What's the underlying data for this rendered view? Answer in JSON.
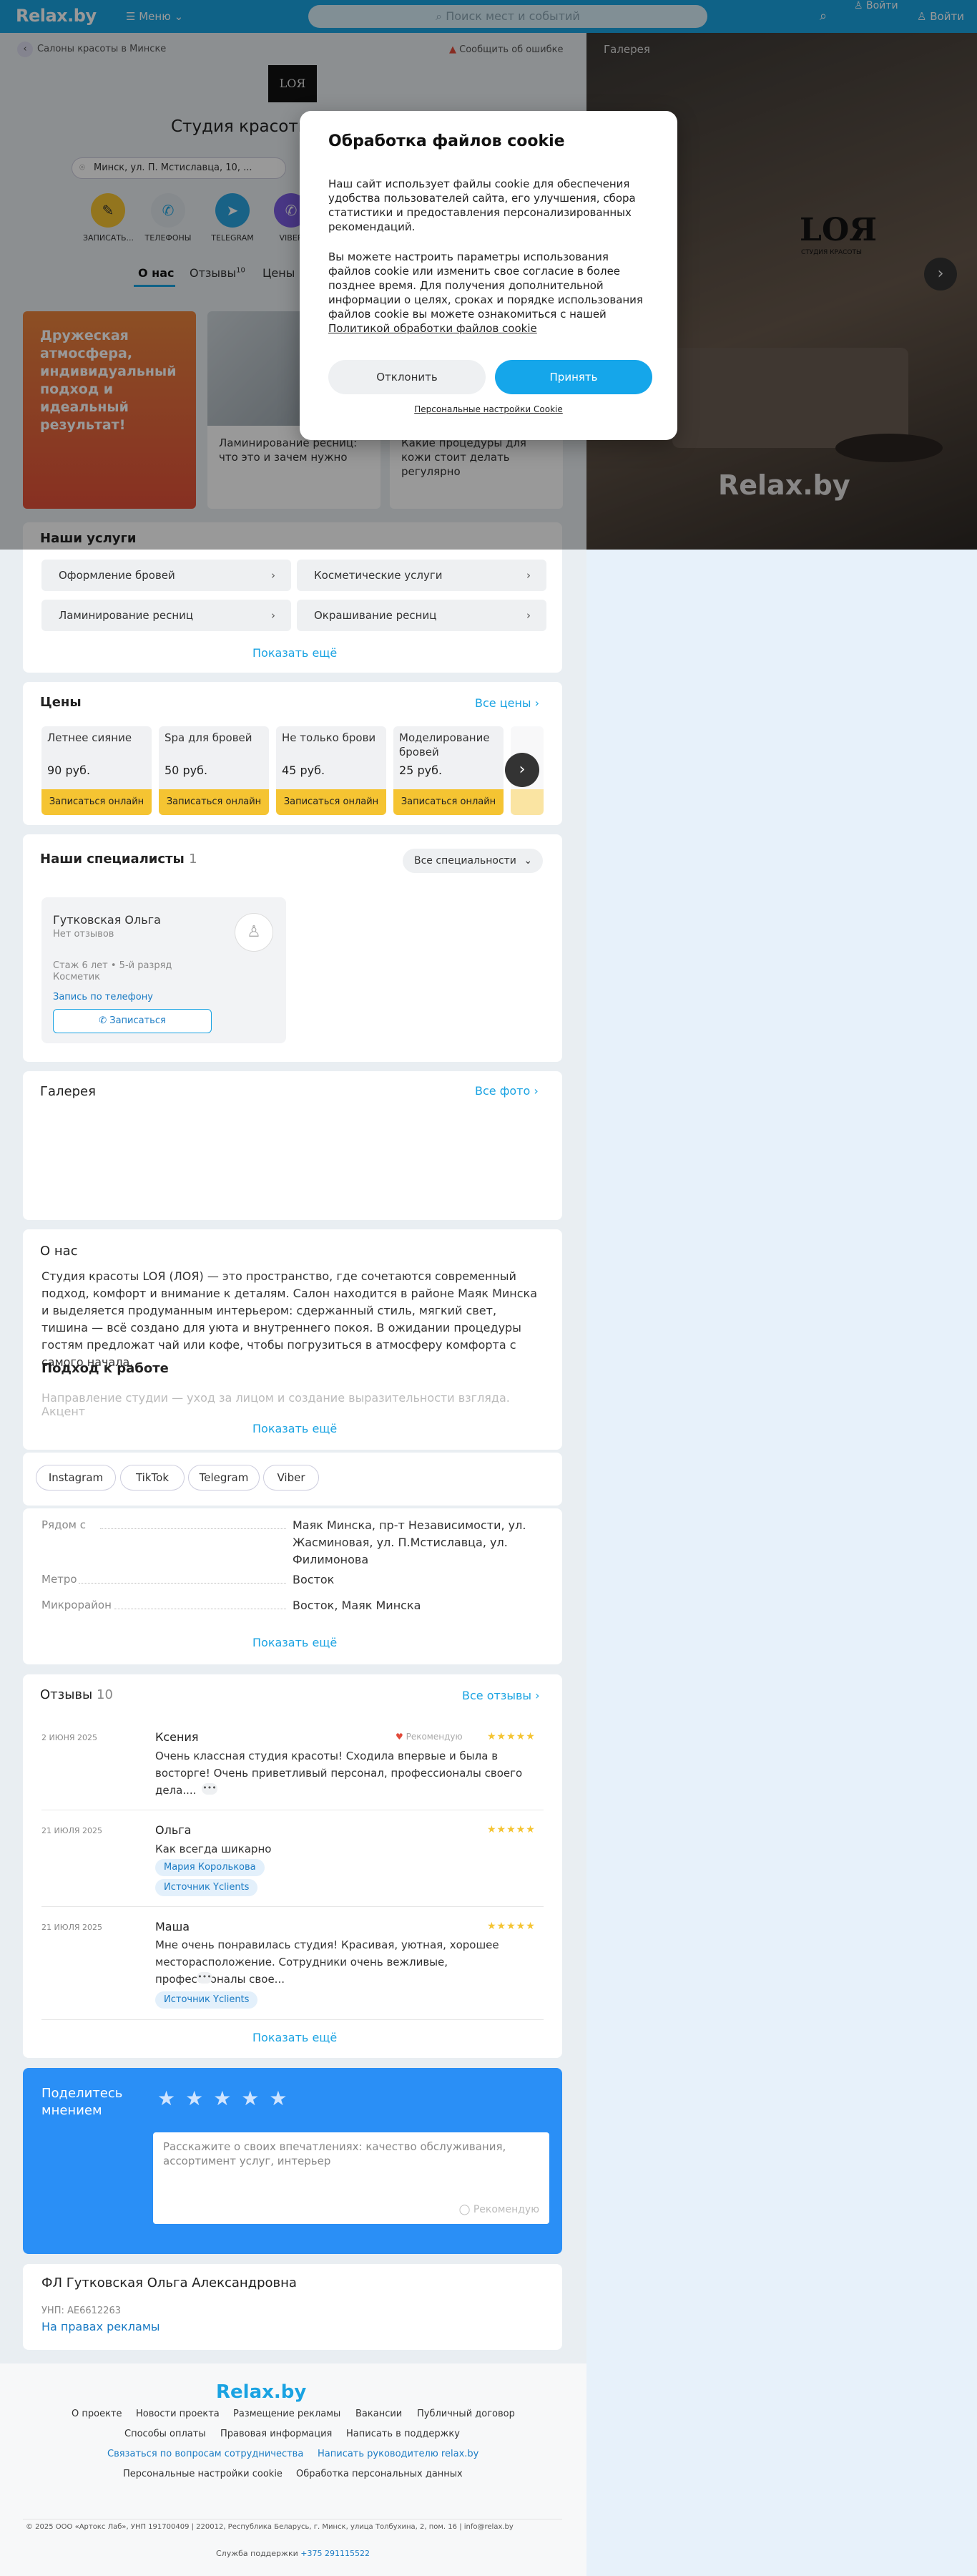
{
  "header": {
    "logo": "Relax.by",
    "menu": "Меню",
    "search_placeholder": "Поиск мест и событий",
    "login1": "Войти",
    "login2": "Войти"
  },
  "breadcrumb": {
    "back": "Салоны красоты в Минске",
    "report": "Сообщить об ошибке"
  },
  "salon": {
    "logo_text": "LOЯ",
    "title": "Студия красоты LOЯ (ЛОЯ)",
    "address": "Минск, ул. П. Мстиславца, 10, ...",
    "actions": [
      "ЗАПИСАТЬ...",
      "ТЕЛЕФОНЫ",
      "TELEGRAM",
      "VIBER"
    ]
  },
  "tabs": {
    "about": "О нас",
    "reviews": "Отзывы",
    "reviews_count": "10",
    "prices": "Цены"
  },
  "promo": {
    "text": "Дружеская атмосфера, индивидуальный подход и идеальный результат!"
  },
  "articles": [
    {
      "title": "Ламинирование ресниц: что это и зачем нужно"
    },
    {
      "title": "Какие процедуры для кожи стоит делать регулярно"
    }
  ],
  "services": {
    "title": "Наши услуги",
    "items": [
      "Оформление бровей",
      "Косметические услуги",
      "Ламинирование ресниц",
      "Окрашивание ресниц"
    ],
    "more": "Показать ещё"
  },
  "prices": {
    "title": "Цены",
    "all": "Все цены",
    "items": [
      {
        "name": "Летнее сияние",
        "price": "90 руб."
      },
      {
        "name": "Spa для бровей",
        "price": "50 руб."
      },
      {
        "name": "Не только брови",
        "price": "45 руб."
      },
      {
        "name": "Моделирование бровей",
        "price": "25 руб."
      }
    ],
    "book": "Записаться онлайн"
  },
  "specialists": {
    "title": "Наши специалисты",
    "count": "1",
    "filter": "Все специальности",
    "card": {
      "name": "Гутковская Ольга",
      "reviews": "Нет отзывов",
      "exp": "Стаж 6 лет • 5-й разряд",
      "role": "Косметик",
      "phone_link": "Запись по телефону",
      "book": "Записаться"
    }
  },
  "gallery_section": {
    "title": "Галерея",
    "all": "Все фото"
  },
  "about": {
    "title": "О нас",
    "p1": "Студия красоты LOЯ (ЛОЯ) — это пространство, где сочетаются современный подход, комфорт и внимание к деталям. Салон находится в районе Маяк Минска и выделяется продуманным интерьером: сдержанный стиль, мягкий свет, тишина — всё создано для уюта и внутреннего покоя. В ожидании процедуры гостям предложат чай или кофе, чтобы погрузиться в атмосферу комфорта с самого начала.",
    "h2": "Подход к работе",
    "p2": "Направление студии — уход за лицом и создание выразительности взгляда. Акцент",
    "more": "Показать ещё"
  },
  "social": [
    "Instagram",
    "TikTok",
    "Telegram",
    "Viber"
  ],
  "info": {
    "rows": [
      {
        "k": "Рядом с",
        "v": "Маяк Минска, пр-т Независимости, ул. Жасминовая, ул. П.Мстиславца, ул. Филимонова"
      },
      {
        "k": "Метро",
        "v": "Восток"
      },
      {
        "k": "Микрорайон",
        "v": "Восток, Маяк Минска"
      }
    ],
    "more": "Показать ещё"
  },
  "reviews": {
    "title": "Отзывы",
    "count": "10",
    "all": "Все отзывы",
    "recommend": "Рекомендую",
    "items": [
      {
        "date": "2 ИЮНЯ 2025",
        "name": "Ксения",
        "text": "Очень классная студия красоты! Сходила впервые и была в восторге! Очень приветливый персонал, профессионалы своего дела...."
      },
      {
        "date": "21 ИЮЛЯ 2025",
        "name": "Ольга",
        "text": "Как всегда шикарно",
        "chip1": "Мария Королькова",
        "chip2": "Источник Yclients"
      },
      {
        "date": "21 ИЮЛЯ 2025",
        "name": "Маша",
        "text": "Мне очень понравилась студия! Красивая, уютная, хорошее месторасположение. Сотрудники очень вежливые, профессионалы свое...",
        "chip1": "Источник Yclients"
      }
    ],
    "more": "Показать ещё"
  },
  "share": {
    "title": "Поделитесь мнением",
    "placeholder": "Расскажите о своих впечатлениях: качество обслуживания, ассортимент услуг, интерьер",
    "recommend": "Рекомендую"
  },
  "legal": {
    "name": "ФЛ Гутковская Ольга Александровна",
    "unp": "УНП: AE6612263",
    "rights": "На правах рекламы"
  },
  "footer": {
    "logo": "Relax.by",
    "row1": [
      "О проекте",
      "Новости проекта",
      "Размещение рекламы",
      "Вакансии",
      "Публичный договор"
    ],
    "row2": [
      "Способы оплаты",
      "Правовая информация",
      "Написать в поддержку"
    ],
    "row3": [
      "Связаться по вопросам сотрудничества",
      "Написать руководителю relax.by"
    ],
    "row4": [
      "Персональные настройки cookie",
      "Обработка персональных данных"
    ],
    "copyright": "© 2025 ООО «Артокс Лаб», УНП 191700409 | 220012, Республика Беларусь, г. Минск, улица Толбухина, 2, пом. 16 | info@relax.by",
    "support": "Служба поддержки",
    "phone": "+375 291115522"
  },
  "gallery_panel": {
    "label": "Галерея",
    "wordmark": "Relax.by",
    "sign1": "LOЯ",
    "sign2": "СТУДИЯ КРАСОТЫ"
  },
  "cookie": {
    "title": "Обработка файлов cookie",
    "p1": "Наш сайт использует файлы cookie для обеспечения удобства пользователей сайта, его улучшения, сбора статистики и предоставления персонализированных рекомендаций.",
    "p2": "Вы можете настроить параметры использования файлов cookie или изменить свое согласие в более позднее время. Для получения дополнительной информации о целях, сроках и порядке использования файлов cookie вы можете ознакомиться с нашей",
    "policy_link": "Политикой обработки файлов cookie",
    "decline": "Отклонить",
    "accept": "Принять",
    "settings": "Персональные настройки Cookie"
  }
}
